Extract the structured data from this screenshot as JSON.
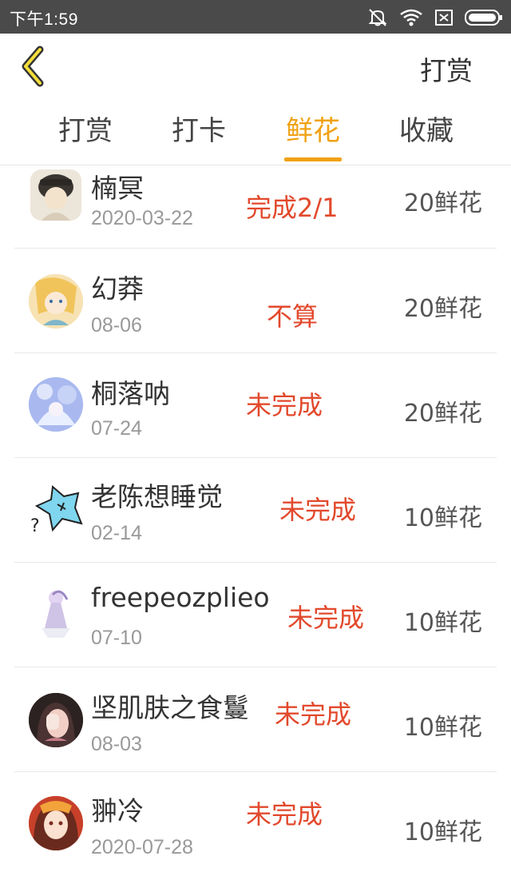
{
  "status_bar": {
    "time": "下午1:59",
    "icons": [
      "mute-icon",
      "wifi-icon",
      "sim-icon",
      "battery-icon"
    ]
  },
  "header": {
    "back_icon": "chevron-left-icon",
    "action_label": "打赏"
  },
  "tabs": [
    {
      "label": "打赏",
      "active": false
    },
    {
      "label": "打卡",
      "active": false
    },
    {
      "label": "鲜花",
      "active": true
    },
    {
      "label": "收藏",
      "active": false
    }
  ],
  "colors": {
    "accent": "#f0a113",
    "status_red": "#e2492c",
    "status_bar_bg": "#4a4a4a"
  },
  "rows": [
    {
      "name": "楠冥",
      "date": "2020-03-22",
      "status": "完成2/1",
      "amount": "20鲜花"
    },
    {
      "name": "幻莽",
      "date": "08-06",
      "status": "不算",
      "amount": "20鲜花"
    },
    {
      "name": "桐落呐",
      "date": "07-24",
      "status": "未完成",
      "amount": "20鲜花"
    },
    {
      "name": "老陈想睡觉",
      "date": "02-14",
      "status": "未完成",
      "amount": "10鲜花"
    },
    {
      "name": "freepeozplieo",
      "date": "07-10",
      "status": "未完成",
      "amount": "10鲜花"
    },
    {
      "name": "坚肌肤之食鬘",
      "date": "08-03",
      "status": "未完成",
      "amount": "10鲜花"
    },
    {
      "name": "翀冷",
      "date": "2020-07-28",
      "status": "未完成",
      "amount": "10鲜花"
    }
  ]
}
